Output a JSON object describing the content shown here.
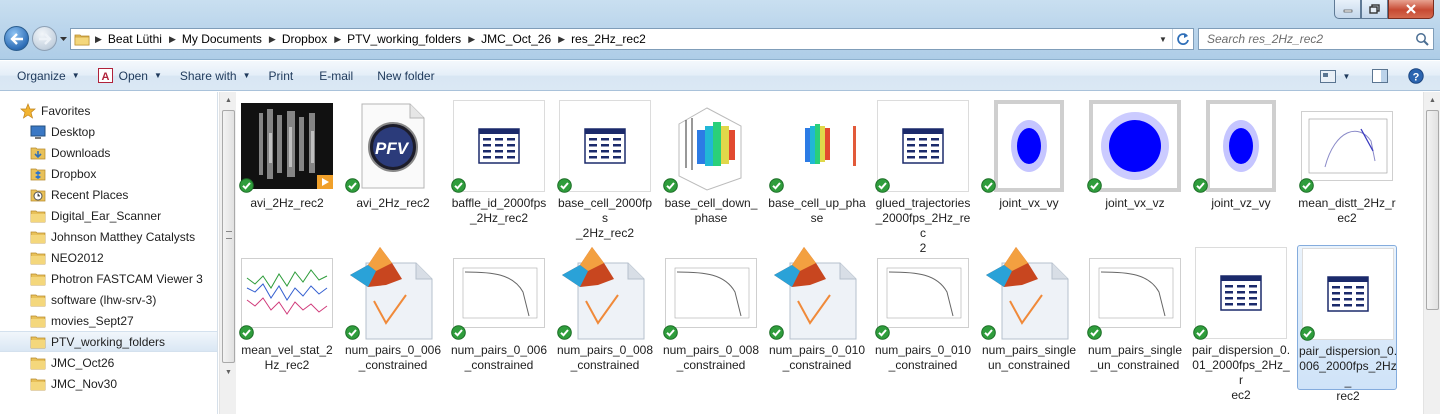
{
  "window": {
    "buttons": [
      "minimize",
      "maximize",
      "close"
    ]
  },
  "address": {
    "crumbs": [
      "Beat Lüthi",
      "My Documents",
      "Dropbox",
      "PTV_working_folders",
      "JMC_Oct_26",
      "res_2Hz_rec2"
    ]
  },
  "search": {
    "placeholder": "Search res_2Hz_rec2"
  },
  "toolbar": {
    "organize": "Organize",
    "open": "Open",
    "share_with": "Share with",
    "print": "Print",
    "email": "E-mail",
    "new_folder": "New folder"
  },
  "nav": {
    "favorites": "Favorites",
    "items": [
      {
        "label": "Desktop",
        "icon": "desktop-icon"
      },
      {
        "label": "Downloads",
        "icon": "downloads-folder-icon"
      },
      {
        "label": "Dropbox",
        "icon": "dropbox-folder-icon"
      },
      {
        "label": "Recent Places",
        "icon": "recent-places-icon"
      }
    ],
    "folders": [
      {
        "label": "Digital_Ear_Scanner",
        "selected": false
      },
      {
        "label": "Johnson Matthey Catalysts",
        "selected": false
      },
      {
        "label": "NEO2012",
        "selected": false
      },
      {
        "label": "Photron FASTCAM Viewer 3",
        "selected": false
      },
      {
        "label": "software (lhw-srv-3)",
        "selected": false
      },
      {
        "label": "movies_Sept27",
        "selected": false
      },
      {
        "label": "PTV_working_folders",
        "selected": true
      },
      {
        "label": "JMC_Oct26",
        "selected": false
      },
      {
        "label": "JMC_Nov30",
        "selected": false
      }
    ]
  },
  "files": [
    {
      "line1": "avi_2Hz_rec2",
      "line2": "",
      "line3": "",
      "line4": "",
      "thumb": "video-thumbnail",
      "selected": false
    },
    {
      "line1": "avi_2Hz_rec2",
      "line2": "",
      "line3": "",
      "line4": "",
      "thumb": "pfv-file-icon",
      "selected": false
    },
    {
      "line1": "baffle_id_2000fps",
      "line2": "_2Hz_rec2",
      "line3": "",
      "line4": "",
      "thumb": "table-file-icon",
      "selected": false
    },
    {
      "line1": "base_cell_2000fps",
      "line2": "_2Hz_rec2",
      "line3": "",
      "line4": "",
      "thumb": "table-file-icon",
      "selected": false
    },
    {
      "line1": "base_cell_down_",
      "line2": "phase",
      "line3": "",
      "line4": "",
      "thumb": "3d-plot-thumbnail",
      "selected": false
    },
    {
      "line1": "base_cell_up_pha",
      "line2": "se",
      "line3": "",
      "line4": "",
      "thumb": "3d-plot-small-thumbnail",
      "selected": false
    },
    {
      "line1": "glued_trajectories",
      "line2": "_2000fps_2Hz_rec",
      "line3": "2",
      "line4": "",
      "thumb": "table-file-icon",
      "selected": false
    },
    {
      "line1": "joint_vx_vy",
      "line2": "",
      "line3": "",
      "line4": "",
      "thumb": "scatter-blob-thumbnail",
      "selected": false
    },
    {
      "line1": "joint_vx_vz",
      "line2": "",
      "line3": "",
      "line4": "",
      "thumb": "scatter-blob-wide-thumbnail",
      "selected": false
    },
    {
      "line1": "joint_vz_vy",
      "line2": "",
      "line3": "",
      "line4": "",
      "thumb": "scatter-blob-thumbnail",
      "selected": false
    },
    {
      "line1": "mean_distt_2Hz_r",
      "line2": "ec2",
      "line3": "",
      "line4": "",
      "thumb": "curve-plot-thumbnail",
      "selected": false
    },
    {
      "line1": "mean_vel_stat_2",
      "line2": "Hz_rec2",
      "line3": "",
      "line4": "",
      "thumb": "multi-line-plot-thumbnail",
      "selected": false
    },
    {
      "line1": "num_pairs_0_006",
      "line2": "_constrained",
      "line3": "",
      "line4": "",
      "thumb": "matlab-fig-icon",
      "selected": false
    },
    {
      "line1": "num_pairs_0_006",
      "line2": "_constrained",
      "line3": "",
      "line4": "",
      "thumb": "decay-plot-thumbnail",
      "selected": false
    },
    {
      "line1": "num_pairs_0_008",
      "line2": "_constrained",
      "line3": "",
      "line4": "",
      "thumb": "matlab-fig-icon",
      "selected": false
    },
    {
      "line1": "num_pairs_0_008",
      "line2": "_constrained",
      "line3": "",
      "line4": "",
      "thumb": "decay-plot-thumbnail",
      "selected": false
    },
    {
      "line1": "num_pairs_0_010",
      "line2": "_constrained",
      "line3": "",
      "line4": "",
      "thumb": "matlab-fig-icon",
      "selected": false
    },
    {
      "line1": "num_pairs_0_010",
      "line2": "_constrained",
      "line3": "",
      "line4": "",
      "thumb": "decay-plot-thumbnail",
      "selected": false
    },
    {
      "line1": "num_pairs_single",
      "line2": "un_constrained",
      "line3": "",
      "line4": "",
      "thumb": "matlab-fig-icon",
      "selected": false
    },
    {
      "line1": "num_pairs_single",
      "line2": "_un_constrained",
      "line3": "",
      "line4": "",
      "thumb": "decay-plot-thumbnail",
      "selected": false
    },
    {
      "line1": "pair_dispersion_0.",
      "line2": "01_2000fps_2Hz_r",
      "line3": "ec2",
      "line4": "",
      "thumb": "table-file-icon",
      "selected": false
    },
    {
      "line1": "pair_dispersion_0.",
      "line2": "006_2000fps_2Hz_",
      "line3": "rec2",
      "line4": "",
      "thumb": "table-file-icon",
      "selected": true
    }
  ]
}
